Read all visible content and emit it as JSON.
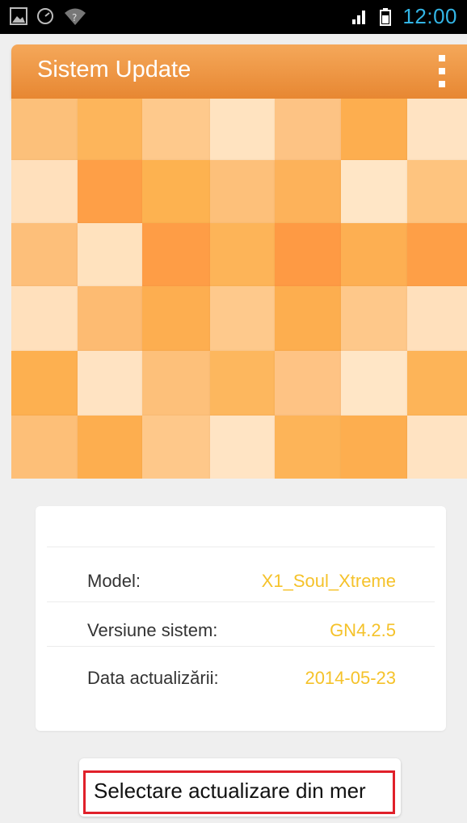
{
  "status_bar": {
    "time": "12:00",
    "left_icons": [
      "image-icon",
      "gauge-icon",
      "wifi-question-icon"
    ],
    "right_icons": [
      "signal-icon",
      "battery-icon"
    ],
    "accent_color": "#33b5e5"
  },
  "action_bar": {
    "title": "Sistem Update",
    "menu_icon": "overflow-menu-icon",
    "color": "#eb8f3a"
  },
  "device_info": {
    "rows": [
      {
        "label": "Model:",
        "value": "X1_Soul_Xtreme"
      },
      {
        "label": "Versiune sistem:",
        "value": "GN4.2.5"
      },
      {
        "label": "Data actualizării:",
        "value": "2014-05-23"
      }
    ],
    "value_color": "#f5c22a"
  },
  "select_button": {
    "label": "Selectare actualizare din mer"
  }
}
